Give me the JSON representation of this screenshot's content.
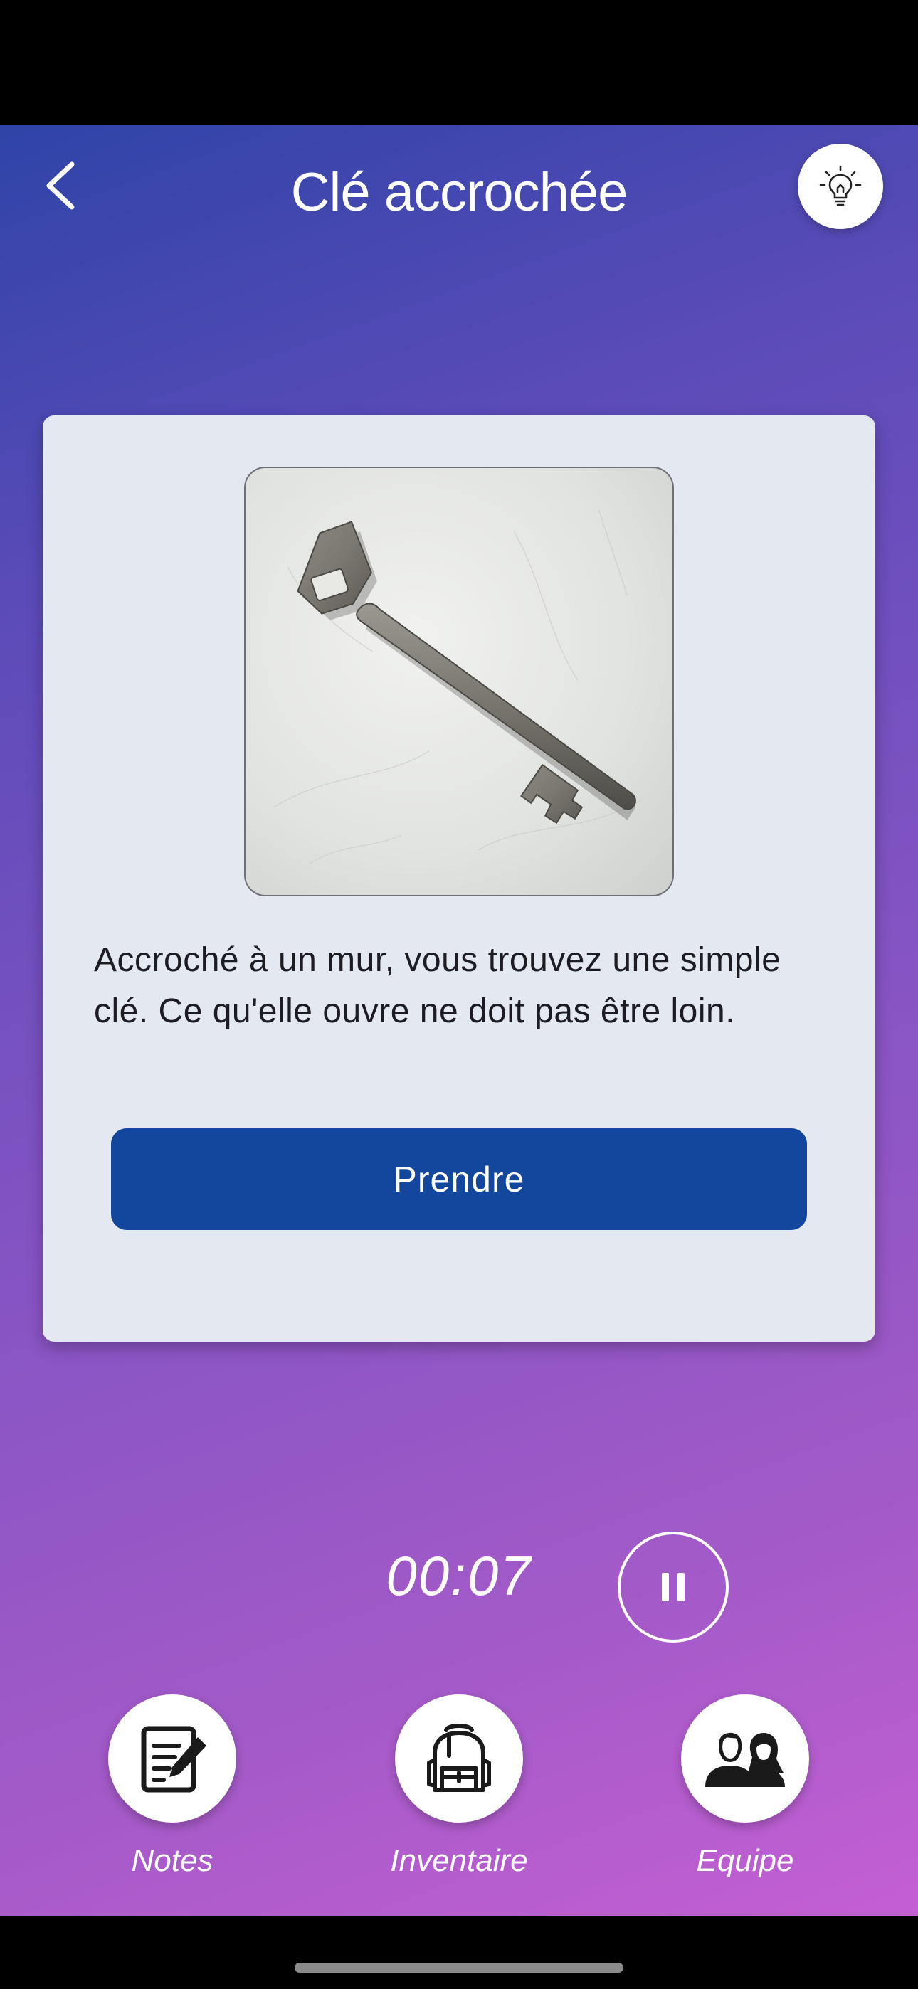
{
  "header": {
    "title": "Clé accrochée",
    "back_icon": "chevron-left-icon",
    "hint_icon": "lightbulb-icon"
  },
  "card": {
    "image_subject": "key",
    "description": "Accroché à un mur, vous trouvez une simple clé. Ce qu'elle ouvre ne doit pas être loin.",
    "action_label": "Prendre"
  },
  "timer": {
    "value": "00:07",
    "pause_icon": "pause-icon"
  },
  "bottom_nav": [
    {
      "label": "Notes",
      "icon": "notes-edit-icon"
    },
    {
      "label": "Inventaire",
      "icon": "backpack-icon"
    },
    {
      "label": "Equipe",
      "icon": "team-icon"
    }
  ],
  "colors": {
    "gradient_top": "#2f44a8",
    "gradient_bottom": "#c45fd4",
    "card_background": "#e4e8f1",
    "primary_button": "#13479e"
  }
}
